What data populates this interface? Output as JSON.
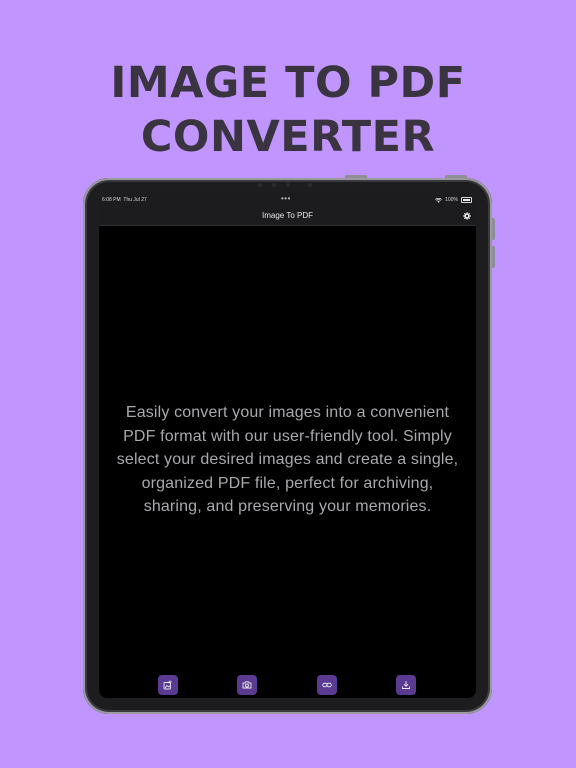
{
  "headline": {
    "line1": "IMAGE TO PDF",
    "line2": "CONVERTER"
  },
  "status_bar": {
    "time": "6:08 PM",
    "date": "Thu Jul 27",
    "dots": "•••",
    "battery": "100%"
  },
  "nav": {
    "title": "Image To PDF",
    "settings_icon": "gear-icon"
  },
  "content": {
    "description_lines": [
      "Easily convert your images into a convenient",
      "PDF format with our user-friendly tool. Simply",
      "select your desired images and create a single,",
      "organized PDF file, perfect for archiving,",
      "sharing, and preserving your memories."
    ]
  },
  "toolbar": {
    "buttons": [
      {
        "icon": "photo-library-icon"
      },
      {
        "icon": "camera-icon"
      },
      {
        "icon": "link-icon"
      },
      {
        "icon": "download-icon"
      }
    ]
  },
  "colors": {
    "background": "#c195fe",
    "headline": "#3a3440",
    "accent": "#5b3a92",
    "screen": "#000000"
  }
}
